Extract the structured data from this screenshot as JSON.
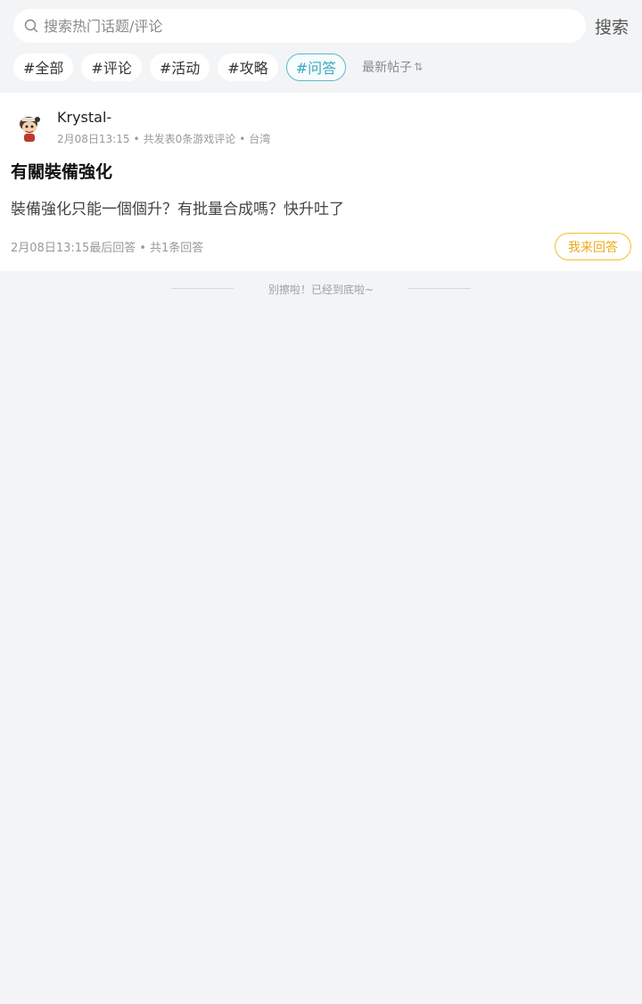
{
  "search": {
    "placeholder": "搜索热门话题/评论",
    "button_label": "搜索"
  },
  "tags": [
    {
      "label": "#全部",
      "active": false
    },
    {
      "label": "#评论",
      "active": false
    },
    {
      "label": "#活动",
      "active": false
    },
    {
      "label": "#攻略",
      "active": false
    },
    {
      "label": "#问答",
      "active": true
    }
  ],
  "sort": {
    "label": "最新帖子",
    "icon": "sort-arrows-icon"
  },
  "post": {
    "username": "Krystal-",
    "date": "2月08日13:15",
    "review_count_text": "共发表0条游戏评论",
    "location": "台湾",
    "title": "有關裝備強化",
    "body": "裝備強化只能一個個升？有批量合成嗎？快升吐了",
    "last_reply": "2月08日13:15最后回答",
    "reply_count": "共1条回答",
    "answer_button": "我来回答"
  },
  "end_message": "别擦啦！已经到底啦~",
  "colors": {
    "accent": "#3aa6bb",
    "answer": "#eda91a",
    "background": "#f3f4f6"
  }
}
